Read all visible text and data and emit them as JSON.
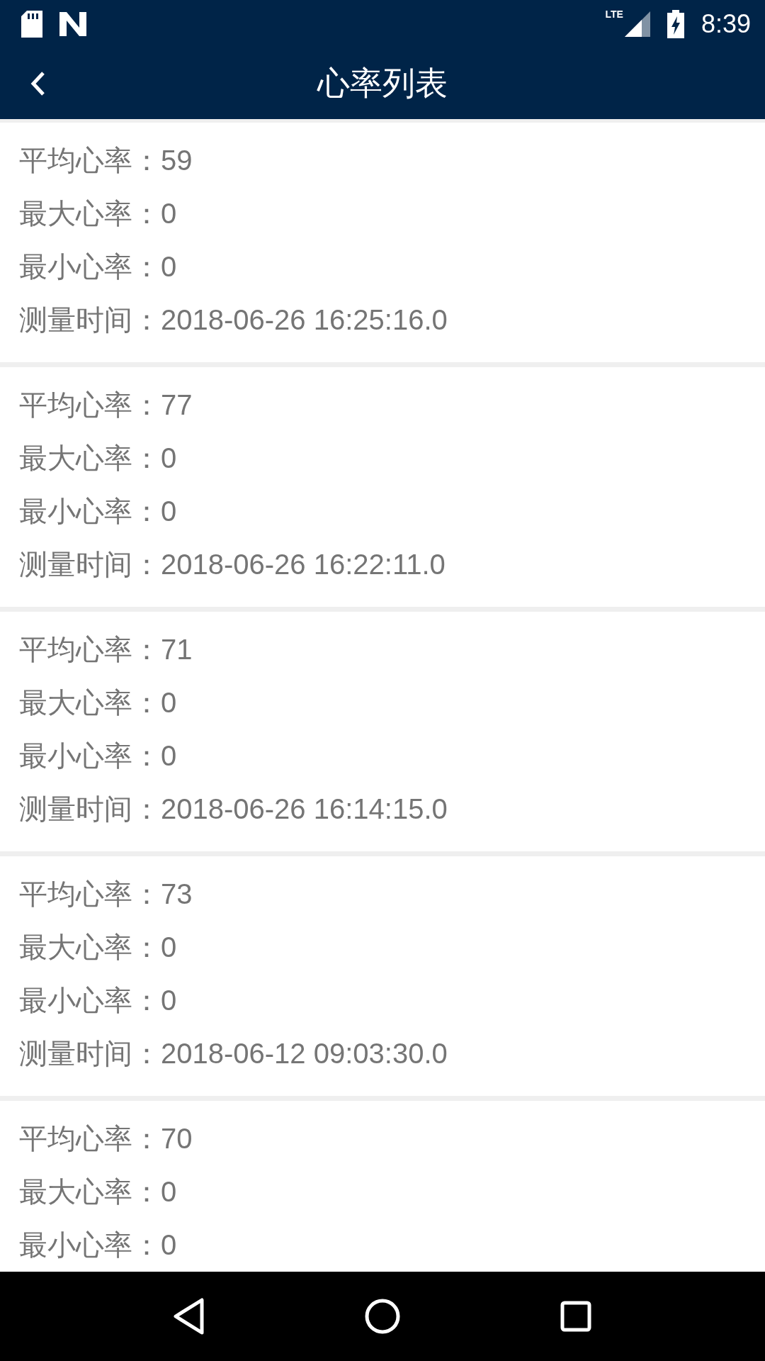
{
  "status_bar": {
    "network": "LTE",
    "time": "8:39"
  },
  "toolbar": {
    "title": "心率列表"
  },
  "records": [
    {
      "lines": [
        {
          "label": "平均心率：",
          "value": "59"
        },
        {
          "label": "最大心率：",
          "value": "0"
        },
        {
          "label": "最小心率：",
          "value": "0"
        },
        {
          "label": "测量时间：",
          "value": "2018-06-26 16:25:16.0"
        }
      ]
    },
    {
      "lines": [
        {
          "label": "平均心率：",
          "value": "77"
        },
        {
          "label": "最大心率：",
          "value": "0"
        },
        {
          "label": "最小心率：",
          "value": "0"
        },
        {
          "label": "测量时间：",
          "value": "2018-06-26 16:22:11.0"
        }
      ]
    },
    {
      "lines": [
        {
          "label": "平均心率：",
          "value": "71"
        },
        {
          "label": "最大心率：",
          "value": "0"
        },
        {
          "label": "最小心率：",
          "value": "0"
        },
        {
          "label": "测量时间：",
          "value": "2018-06-26 16:14:15.0"
        }
      ]
    },
    {
      "lines": [
        {
          "label": "平均心率：",
          "value": "73"
        },
        {
          "label": "最大心率：",
          "value": "0"
        },
        {
          "label": "最小心率：",
          "value": "0"
        },
        {
          "label": "测量时间：",
          "value": "2018-06-12 09:03:30.0"
        }
      ]
    },
    {
      "lines": [
        {
          "label": "平均心率：",
          "value": "70"
        },
        {
          "label": "最大心率：",
          "value": "0"
        },
        {
          "label": "最小心率：",
          "value": "0"
        }
      ]
    }
  ]
}
